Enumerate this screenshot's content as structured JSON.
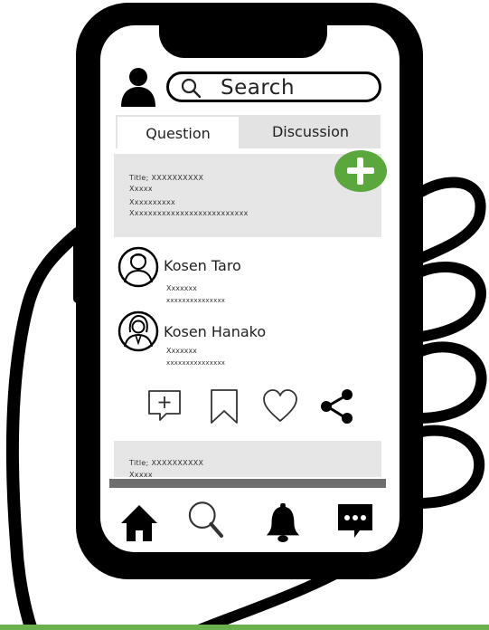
{
  "search": {
    "placeholder": "Search"
  },
  "tabs": [
    {
      "label": "Question"
    },
    {
      "label": "Discussion"
    }
  ],
  "posts": [
    {
      "title": "Title; XXXXXXXXXX",
      "lines": [
        "Xxxxx",
        "Xxxxxxxxxx",
        "Xxxxxxxxxxxxxxxxxxxxxxxxxx"
      ]
    },
    {
      "title": "Title; XXXXXXXXXX",
      "lines": [
        "Xxxxx"
      ]
    }
  ],
  "comments": [
    {
      "name": "Kosen Taro",
      "line1": "Xxxxxxx",
      "line2": "xxxxxxxxxxxxxxx"
    },
    {
      "name": "Kosen Hanako",
      "line1": "Xxxxxxx",
      "line2": "xxxxxxxxxxxxxxx"
    }
  ],
  "actions": [
    "comment-plus-icon",
    "bookmark-icon",
    "heart-icon",
    "share-icon"
  ],
  "bottom_nav": [
    "home-icon",
    "search-icon",
    "bell-icon",
    "message-icon"
  ],
  "colors": {
    "accent": "#5aa83c",
    "tab_inactive": "#e3e3e3",
    "card": "#e6e6e6"
  }
}
